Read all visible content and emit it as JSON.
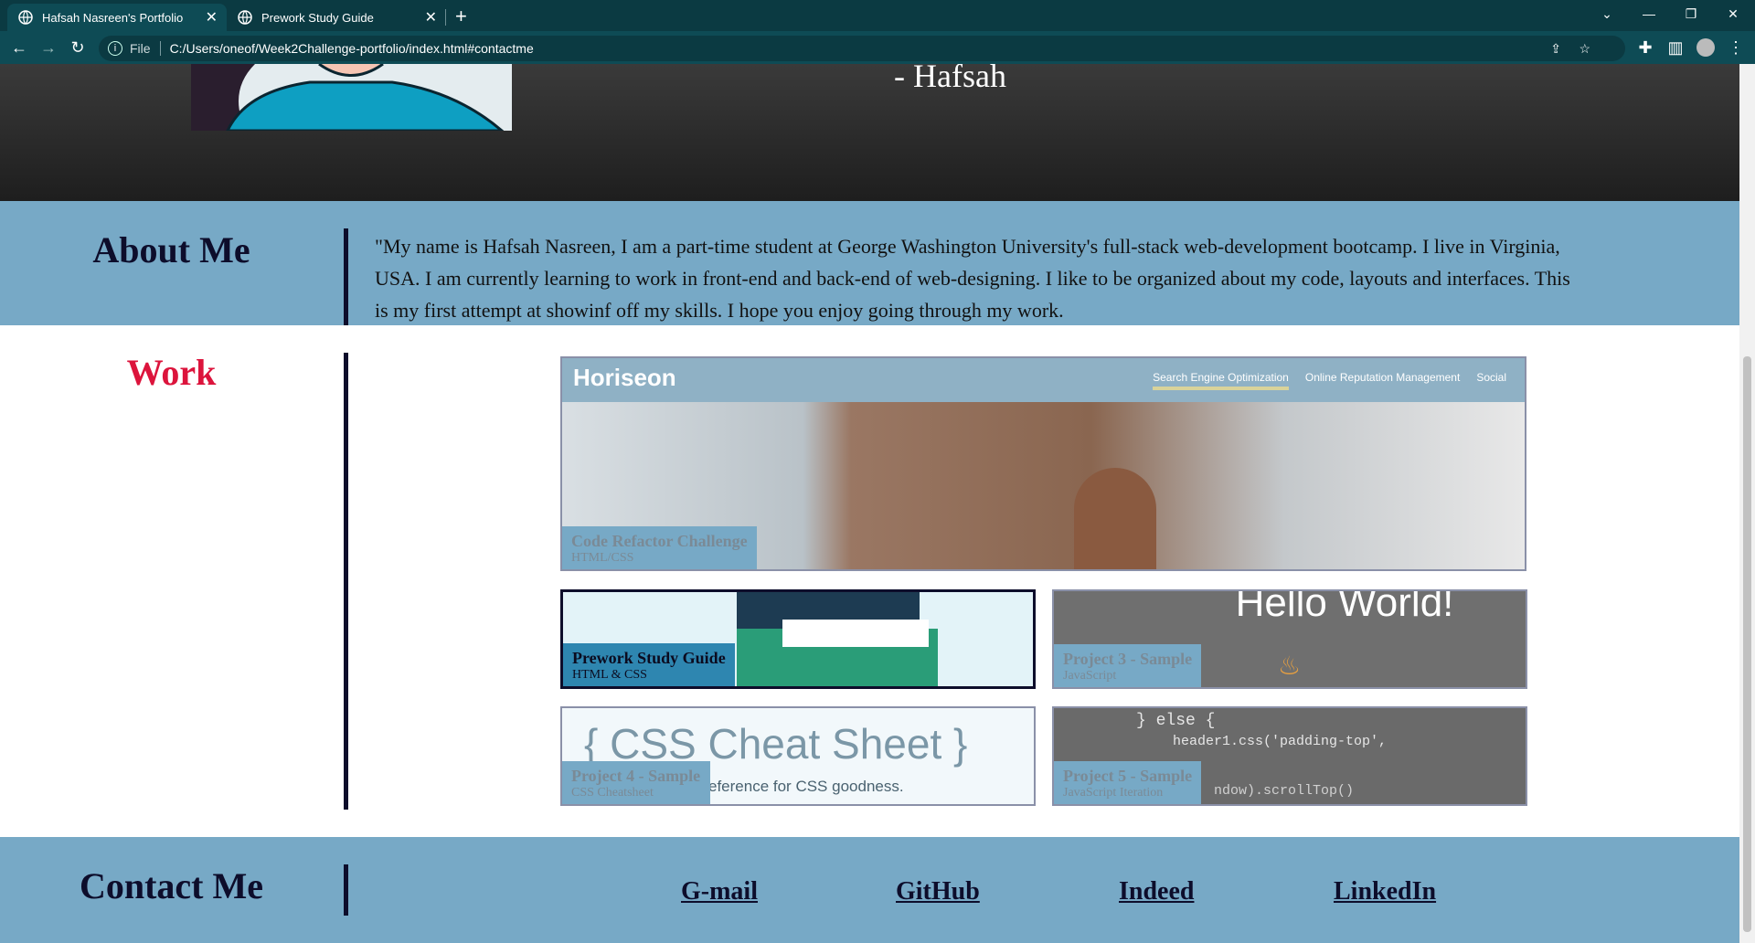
{
  "browser": {
    "tabs": [
      {
        "title": "Hafsah Nasreen's Portfolio",
        "active": true
      },
      {
        "title": "Prework Study Guide",
        "active": false
      }
    ],
    "address": {
      "scheme_label": "File",
      "url": "C:/Users/oneof/Week2Challenge-portfolio/index.html#contactme"
    }
  },
  "hero": {
    "signature": "- Hafsah"
  },
  "about": {
    "title": "About Me",
    "text": "\"My name is Hafsah Nasreen, I am a part-time student at George Washington University's full-stack web-development bootcamp. I live in Virginia, USA. I am currently learning to work in front-end and back-end of web-designing. I like to be organized about my code, layouts and interfaces. This is my first attempt at showinf off my skills. I hope you enjoy going through my work."
  },
  "work": {
    "title": "Work",
    "projects": [
      {
        "title": "Code Refactor Challenge",
        "subtitle": "HTML/CSS",
        "thumb_logo": "Horiseon",
        "thumb_nav": [
          "Search Engine Optimization",
          "Online Reputation Management",
          "Social"
        ]
      },
      {
        "title": "Prework Study Guide",
        "subtitle": "HTML & CSS"
      },
      {
        "title": "Project 3 - Sample",
        "subtitle": "JavaScript",
        "thumb_text": "Hello World!"
      },
      {
        "title": "Project 4 - Sample",
        "subtitle": "CSS Cheatsheet",
        "thumb_heading": "{ CSS Cheat Sheet }",
        "thumb_caption": "eference for CSS goodness."
      },
      {
        "title": "Project 5 - Sample",
        "subtitle": "JavaScript Iteration",
        "thumb_code": [
          "} else {",
          "header1.css('padding-top',",
          "ndow).scrollTop()"
        ]
      }
    ]
  },
  "contact": {
    "title": "Contact Me",
    "links": [
      "G-mail",
      "GitHub",
      "Indeed",
      "LinkedIn"
    ]
  },
  "colors": {
    "section_blue": "#77a9c6",
    "accent_red": "#dc143c",
    "navy": "#0d0d2b",
    "chrome_dark": "#0b3a42"
  }
}
